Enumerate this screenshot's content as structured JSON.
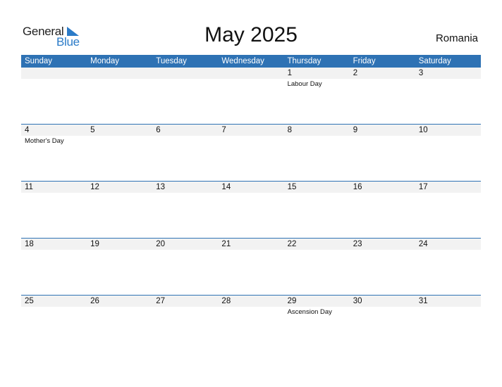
{
  "logo": {
    "general": "General",
    "blue": "Blue"
  },
  "title": "May 2025",
  "country": "Romania",
  "weekdays": [
    "Sunday",
    "Monday",
    "Tuesday",
    "Wednesday",
    "Thursday",
    "Friday",
    "Saturday"
  ],
  "weeks": [
    [
      {
        "day": ""
      },
      {
        "day": ""
      },
      {
        "day": ""
      },
      {
        "day": ""
      },
      {
        "day": "1",
        "event": "Labour Day"
      },
      {
        "day": "2"
      },
      {
        "day": "3"
      }
    ],
    [
      {
        "day": "4",
        "event": "Mother's Day"
      },
      {
        "day": "5"
      },
      {
        "day": "6"
      },
      {
        "day": "7"
      },
      {
        "day": "8"
      },
      {
        "day": "9"
      },
      {
        "day": "10"
      }
    ],
    [
      {
        "day": "11"
      },
      {
        "day": "12"
      },
      {
        "day": "13"
      },
      {
        "day": "14"
      },
      {
        "day": "15"
      },
      {
        "day": "16"
      },
      {
        "day": "17"
      }
    ],
    [
      {
        "day": "18"
      },
      {
        "day": "19"
      },
      {
        "day": "20"
      },
      {
        "day": "21"
      },
      {
        "day": "22"
      },
      {
        "day": "23"
      },
      {
        "day": "24"
      }
    ],
    [
      {
        "day": "25"
      },
      {
        "day": "26"
      },
      {
        "day": "27"
      },
      {
        "day": "28"
      },
      {
        "day": "29",
        "event": "Ascension Day"
      },
      {
        "day": "30"
      },
      {
        "day": "31"
      }
    ]
  ],
  "colors": {
    "header": "#2e72b4",
    "brand_blue": "#2b7bc8",
    "date_row": "#f2f2f2"
  }
}
